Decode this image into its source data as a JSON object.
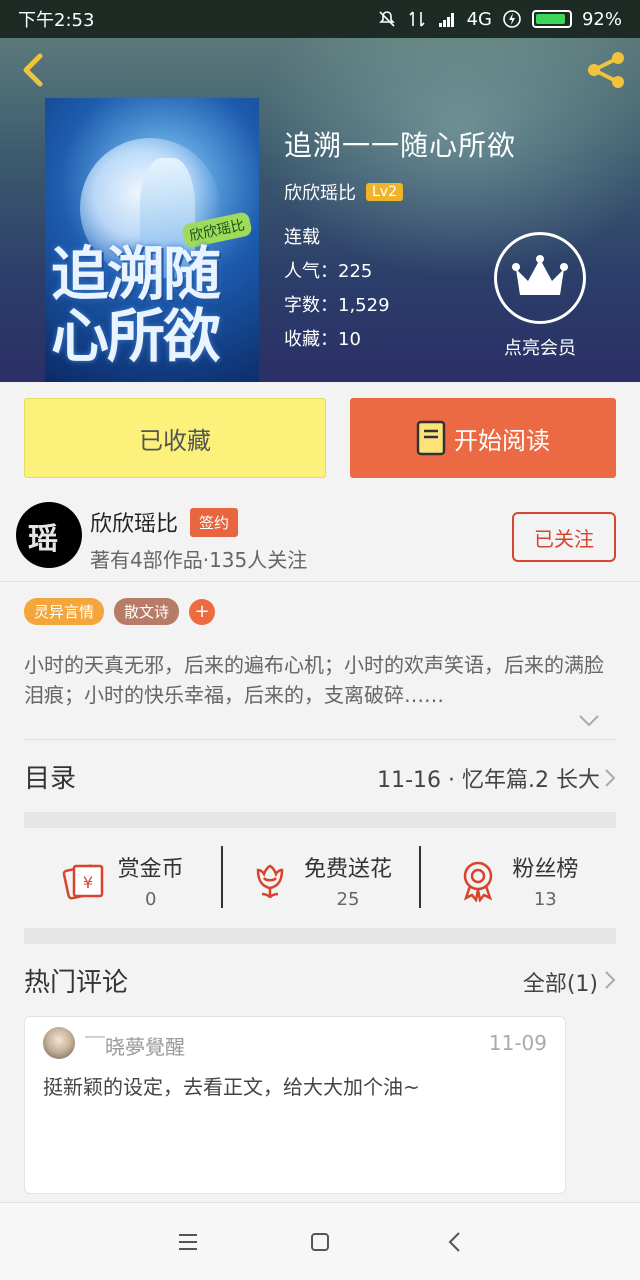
{
  "status_bar": {
    "time": "下午2:53",
    "network": "4G",
    "battery": "92%",
    "battery_level": 0.92
  },
  "book": {
    "title": "追溯一一随心所欲",
    "author": "欣欣瑶比",
    "level": "Lv2",
    "status": "连载",
    "popularity": "人气：225",
    "word_count": "字数：1,529",
    "favorites": "收藏：10",
    "cover_title": "追溯随心所欲",
    "cover_author_tag": "欣欣瑶比"
  },
  "vip": {
    "label": "点亮会员"
  },
  "actions": {
    "collected": "已收藏",
    "start_reading": "开始阅读"
  },
  "author_card": {
    "name": "欣欣瑶比",
    "sign_badge": "签约",
    "stats": "著有4部作品·135人关注",
    "follow": "已关注",
    "avatar_glyph": "瑶"
  },
  "tags": [
    "灵异言情",
    "散文诗"
  ],
  "tag_add": "+",
  "description": "小时的天真无邪，后来的遍布心机；小时的欢声笑语，后来的满脸泪痕；小时的快乐幸福，后来的，支离破碎……",
  "toc": {
    "title": "目录",
    "latest": "11-16 · 忆年篇.2  长大"
  },
  "rewards": [
    {
      "label": "赏金币",
      "value": "0",
      "icon": "coin-envelope-icon"
    },
    {
      "label": "免费送花",
      "value": "25",
      "icon": "flower-icon"
    },
    {
      "label": "粉丝榜",
      "value": "13",
      "icon": "medal-icon"
    }
  ],
  "comments": {
    "title": "热门评论",
    "all_link": "全部(1)",
    "items": [
      {
        "user": "￣晓夢覺醒",
        "date": "11-09",
        "text": "挺新颖的设定，去看正文，给大大加个油~"
      }
    ]
  },
  "colors": {
    "accent": "#ec6a43",
    "collected_bg": "#fcf17a",
    "follow": "#d7462c"
  }
}
